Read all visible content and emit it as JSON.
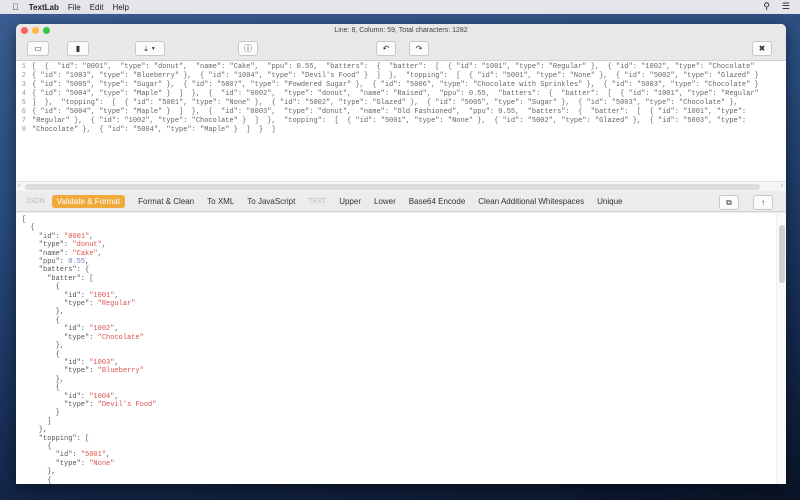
{
  "menubar": {
    "app": "TextLab",
    "items": [
      "File",
      "Edit",
      "Help"
    ]
  },
  "window": {
    "status": "Line: 8, Column: 59, Total characters: 1282"
  },
  "toolbar": {
    "icons": [
      "device-icon",
      "clipboard-icon",
      "download-icon",
      "info-icon",
      "undo-icon",
      "redo-icon",
      "clear-icon"
    ]
  },
  "input_lines": [
    "[  {  \"id\": \"0001\",  \"type\": \"donut\",  \"name\": \"Cake\",  \"ppu\": 0.55,  \"batters\":  {  \"batter\":  [  { \"id\": \"1001\", \"type\": \"Regular\" },  { \"id\": \"1002\", \"type\": \"Chocolate\"",
    "{ \"id\": \"1003\", \"type\": \"Blueberry\" },  { \"id\": \"1004\", \"type\": \"Devil's Food\" }  ]  },  \"topping\":  [  { \"id\": \"5001\", \"type\": \"None\" },  { \"id\": \"5002\", \"type\": \"Glazed\" }",
    "{ \"id\": \"5005\", \"type\": \"Sugar\" },  { \"id\": \"5007\", \"type\": \"Powdered Sugar\" },  { \"id\": \"5006\", \"type\": \"Chocolate with Sprinkles\" },  { \"id\": \"5003\", \"type\": \"Chocolate\" }",
    "{ \"id\": \"5004\", \"type\": \"Maple\" }  ]  },  {  \"id\": \"0002\",  \"type\": \"donut\",  \"name\": \"Raised\",  \"ppu\": 0.55,  \"batters\":  {  \"batter\":  [  { \"id\": \"1001\", \"type\": \"Regular\"",
    "]  },  \"topping\":  [  { \"id\": \"5001\", \"type\": \"None\" },  { \"id\": \"5002\", \"type\": \"Glazed\" },  { \"id\": \"5005\", \"type\": \"Sugar\" },  { \"id\": \"5003\", \"type\": \"Chocolate\" },",
    "{ \"id\": \"5004\", \"type\": \"Maple\" }  ]  },  {  \"id\": \"0003\",  \"type\": \"donut\",  \"name\": \"Old Fashioned\",  \"ppu\": 0.55,  \"batters\":  {  \"batter\":  [  { \"id\": \"1001\", \"type\":",
    "\"Regular\" },  { \"id\": \"1002\", \"type\": \"Chocolate\" }  ]  },  \"topping\":  [  { \"id\": \"5001\", \"type\": \"None\" },  { \"id\": \"5002\", \"type\": \"Glazed\" },  { \"id\": \"5003\", \"type\":",
    "\"Chocolate\" },  { \"id\": \"5004\", \"type\": \"Maple\" }  ]  }  ]"
  ],
  "actions": {
    "json_label": "JSON",
    "validate": "Validate & Format",
    "format_clean": "Format & Clean",
    "to_xml": "To XML",
    "to_js": "To JavaScript",
    "text_label": "TEXT",
    "upper": "Upper",
    "lower": "Lower",
    "base64": "Base64 Encode",
    "clean_ws": "Clean Additional Whitespaces",
    "unique": "Unique"
  },
  "colors": {
    "accent": "#f2a93b",
    "string": "#d9534f",
    "number": "#6b7fc4"
  },
  "output_lines": [
    {
      "k": "[",
      "v": "",
      "t": "",
      "p": ""
    },
    {
      "k": "  {",
      "v": "",
      "t": "",
      "p": ""
    },
    {
      "k": "    \"id\": ",
      "v": "\"0001\"",
      "t": "str",
      "p": ","
    },
    {
      "k": "    \"type\": ",
      "v": "\"donut\"",
      "t": "str",
      "p": ","
    },
    {
      "k": "    \"name\": ",
      "v": "\"Cake\"",
      "t": "str",
      "p": ","
    },
    {
      "k": "    \"ppu\": ",
      "v": "0.55",
      "t": "num",
      "p": ","
    },
    {
      "k": "    \"batters\": {",
      "v": "",
      "t": "",
      "p": ""
    },
    {
      "k": "      \"batter\": [",
      "v": "",
      "t": "",
      "p": ""
    },
    {
      "k": "        {",
      "v": "",
      "t": "",
      "p": ""
    },
    {
      "k": "          \"id\": ",
      "v": "\"1001\"",
      "t": "str",
      "p": ","
    },
    {
      "k": "          \"type\": ",
      "v": "\"Regular\"",
      "t": "str",
      "p": ""
    },
    {
      "k": "        },",
      "v": "",
      "t": "",
      "p": ""
    },
    {
      "k": "        {",
      "v": "",
      "t": "",
      "p": ""
    },
    {
      "k": "          \"id\": ",
      "v": "\"1002\"",
      "t": "str",
      "p": ","
    },
    {
      "k": "          \"type\": ",
      "v": "\"Chocolate\"",
      "t": "str",
      "p": ""
    },
    {
      "k": "        },",
      "v": "",
      "t": "",
      "p": ""
    },
    {
      "k": "        {",
      "v": "",
      "t": "",
      "p": ""
    },
    {
      "k": "          \"id\": ",
      "v": "\"1003\"",
      "t": "str",
      "p": ","
    },
    {
      "k": "          \"type\": ",
      "v": "\"Blueberry\"",
      "t": "str",
      "p": ""
    },
    {
      "k": "        },",
      "v": "",
      "t": "",
      "p": ""
    },
    {
      "k": "        {",
      "v": "",
      "t": "",
      "p": ""
    },
    {
      "k": "          \"id\": ",
      "v": "\"1004\"",
      "t": "str",
      "p": ","
    },
    {
      "k": "          \"type\": ",
      "v": "\"Devil's Food\"",
      "t": "str",
      "p": ""
    },
    {
      "k": "        }",
      "v": "",
      "t": "",
      "p": ""
    },
    {
      "k": "      ]",
      "v": "",
      "t": "",
      "p": ""
    },
    {
      "k": "    },",
      "v": "",
      "t": "",
      "p": ""
    },
    {
      "k": "    \"topping\": [",
      "v": "",
      "t": "",
      "p": ""
    },
    {
      "k": "      {",
      "v": "",
      "t": "",
      "p": ""
    },
    {
      "k": "        \"id\": ",
      "v": "\"5001\"",
      "t": "str",
      "p": ","
    },
    {
      "k": "        \"type\": ",
      "v": "\"None\"",
      "t": "str",
      "p": ""
    },
    {
      "k": "      },",
      "v": "",
      "t": "",
      "p": ""
    },
    {
      "k": "      {",
      "v": "",
      "t": "",
      "p": ""
    }
  ]
}
